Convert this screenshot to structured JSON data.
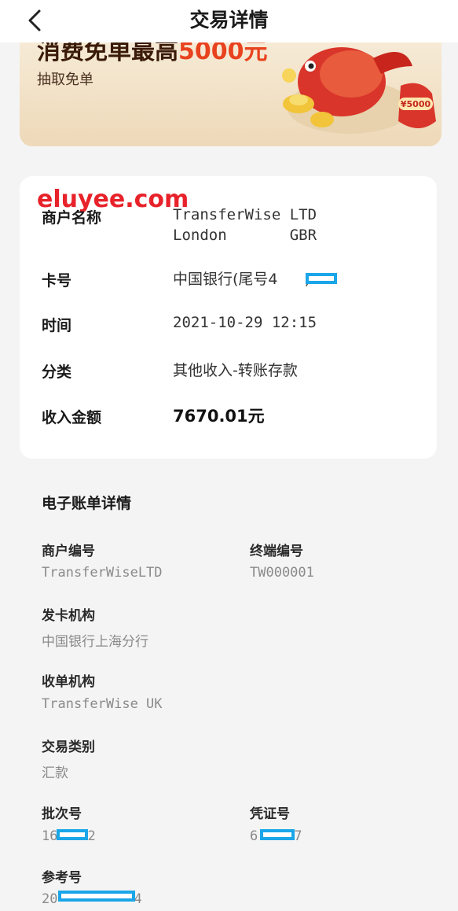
{
  "header": {
    "title": "交易详情",
    "back_icon": "chevron-left-icon"
  },
  "banner": {
    "title_prefix": "消费免单最高",
    "title_highlight": "5000元",
    "link_label": "抽取免单",
    "badge_text": "¥5000"
  },
  "watermark": "eluyee.com",
  "details": {
    "merchant_label": "商户名称",
    "merchant_value": "TransferWise LTD\nLondon       GBR",
    "card_label": "卡号",
    "card_value": "中国银行(尾号4",
    "card_value_end": ")",
    "time_label": "时间",
    "time_value": "2021-10-29 12:15",
    "category_label": "分类",
    "category_value": "其他收入-转账存款",
    "amount_label": "收入金额",
    "amount_value": "7670.01元"
  },
  "ebill": {
    "section_title": "电子账单详情",
    "merchant_no_label": "商户编号",
    "merchant_no_value": "TransferWiseLTD",
    "terminal_no_label": "终端编号",
    "terminal_no_value": "TW000001",
    "issuer_label": "发卡机构",
    "issuer_value": "中国银行上海分行",
    "acquirer_label": "收单机构",
    "acquirer_value": "TransferWise UK",
    "txn_type_label": "交易类别",
    "txn_type_value": "汇款",
    "batch_no_label": "批次号",
    "batch_no_value_start": "16",
    "batch_no_value_end": "2",
    "voucher_no_label": "凭证号",
    "voucher_no_value_start": "6",
    "voucher_no_value_end": "7",
    "ref_no_label": "参考号",
    "ref_no_value_start": "20",
    "ref_no_value_end": "4"
  },
  "colors": {
    "redaction": "#1aa6e8",
    "watermark": "#e8222a",
    "banner_accent": "#e8421e"
  }
}
